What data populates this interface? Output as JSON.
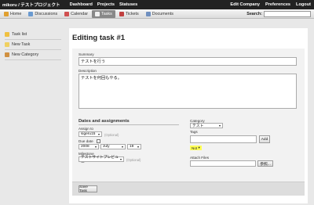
{
  "topbar": {
    "brand": "mikoru / テストプロジェクト",
    "nav": [
      "Dashboard",
      "Projects",
      "Statuses"
    ],
    "right": [
      "Edit Company",
      "Preferences",
      "Logout"
    ]
  },
  "tabs": [
    {
      "label": "Home",
      "icon": "home-icon",
      "active": false
    },
    {
      "label": "Discussions",
      "icon": "discussions-icon",
      "active": false
    },
    {
      "label": "Calendar",
      "icon": "calendar-icon",
      "active": false
    },
    {
      "label": "Tasks",
      "icon": "tasks-icon",
      "active": true
    },
    {
      "label": "Tickets",
      "icon": "tickets-icon",
      "active": false
    },
    {
      "label": "Documents",
      "icon": "documents-icon",
      "active": false
    }
  ],
  "search": {
    "label": "Search:",
    "value": ""
  },
  "sidebar": {
    "items": [
      {
        "label": "Task list",
        "icon": "folder-icon"
      },
      {
        "label": "New Task",
        "icon": "new-task-icon"
      },
      {
        "label": "New Category",
        "icon": "new-category-icon"
      }
    ]
  },
  "page": {
    "title": "Editing task #1"
  },
  "form": {
    "summary_label": "Summary",
    "summary_value": "テストを行う",
    "description_label": "Description",
    "description_value": "テストを何回もやる。",
    "section_title": "Dates and assignments",
    "assign_label": "Assign to",
    "assign_value": "sigeru15",
    "assign_hint": "(Optional)",
    "due_label": "Due date",
    "due_year": "2008",
    "due_month": "July",
    "due_day": "19",
    "milestone_label": "Milestone",
    "milestone_value": "テストサイトプレビュー",
    "milestone_hint": "(Optional)",
    "category_label": "Category",
    "category_value": "テスト",
    "tags_label": "Tags",
    "tags_value": "",
    "add_label": "Add",
    "tag_chip": "Not",
    "attach_label": "Attach Files",
    "attach_value": "",
    "browse_label": "参照...",
    "save_label": "Save Task"
  },
  "colors": {
    "topbar": "#222222",
    "active_tab": "#888888",
    "tag_highlight": "#ffff55"
  }
}
